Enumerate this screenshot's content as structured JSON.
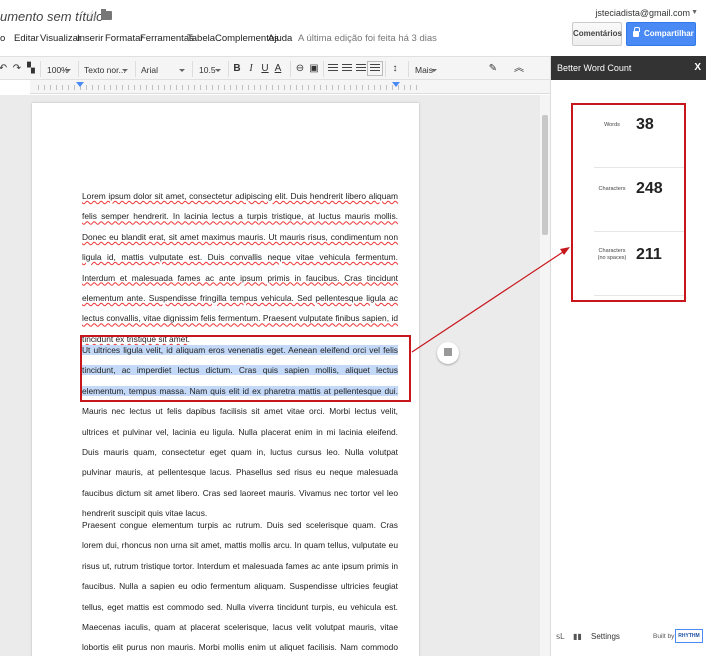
{
  "window": {
    "doc_title": "umento sem título",
    "user_email": "jsteciadista@gmail.com",
    "last_edit": "A última edição foi feita há 3 dias",
    "comments_label": "Comentários",
    "share_label": "Compartilhar"
  },
  "menu": [
    "o",
    "Editar",
    "Visualizar",
    "Inserir",
    "Formatar",
    "Ferramentas",
    "Tabela",
    "Complementos",
    "Ajuda"
  ],
  "toolbar": {
    "zoom": "100%",
    "style": "Texto nor...",
    "font": "Arial",
    "size": "10.5",
    "bold": "B",
    "italic": "I",
    "underline": "U",
    "text_color": "A",
    "more": "Mais"
  },
  "document": {
    "paragraph1": "Lorem ipsum dolor sit amet, consectetur adipiscing elit. Duis hendrerit libero aliquam felis semper hendrerit. In lacinia lectus a turpis tristique, at luctus mauris mollis. Donec eu blandit erat, sit amet maximus mauris. Ut mauris risus, condimentum non ligula id, mattis vulputate est. Duis convallis neque vitae vehicula fermentum. Interdum et malesuada fames ac ante ipsum primis in faucibus. Cras tincidunt elementum ante. Suspendisse fringilla tempus vehicula. Sed pellentesque ligula ac lectus convallis, vitae dignissim felis fermentum. Praesent vulputate finibus sapien, id tincidunt ex tristique sit amet.",
    "paragraph2_selected": "Ut ultrices ligula velit, id aliquam eros venenatis eget. Aenean eleifend orci vel felis tincidunt, ac imperdiet lectus dictum. Cras quis sapien mollis, aliquet lectus elementum, tempus massa. Nam quis elit id ex pharetra mattis at pellentesque dui.",
    "paragraph2_rest": " Mauris nec lectus ut felis dapibus facilisis sit amet vitae orci. Morbi lectus velit, ultrices et pulvinar vel, lacinia eu ligula. Nulla placerat enim in mi lacinia eleifend. Duis mauris quam, consectetur eget quam in, luctus cursus leo. Nulla volutpat pulvinar mauris, at pellentesque lacus. Phasellus sed risus eu neque malesuada faucibus dictum sit amet libero. Cras sed laoreet mauris. Vivamus nec tortor vel leo hendrerit suscipit quis vitae lacus.",
    "paragraph3": "Praesent congue elementum turpis ac rutrum. Duis sed scelerisque quam. Cras lorem dui, rhoncus non urna sit amet, mattis mollis arcu. In quam tellus, vulputate eu risus ut, rutrum tristique tortor. Interdum et malesuada fames ac ante ipsum primis in faucibus. Nulla a sapien eu odio fermentum aliquam. Suspendisse ultricies feugiat tellus, eget mattis est commodo sed. Nulla viverra tincidunt turpis, eu vehicula est. Maecenas iaculis, quam at placerat scelerisque, lacus velit volutpat mauris, vitae lobortis elit purus non mauris. Morbi mollis enim ut aliquet facilisis. Nam commodo arcu eu ullamcorper consequat. Integer eros turpis, convallis eget"
  },
  "sidebar": {
    "title": "Better Word Count",
    "close": "X",
    "stats": [
      {
        "label": "Words",
        "value": "38"
      },
      {
        "label": "Characters",
        "value": "248"
      },
      {
        "label": "Characters\n(no spaces)",
        "value": "211"
      }
    ],
    "settings_label": "Settings",
    "built_by": "Built by",
    "brand": "RHYTHM"
  },
  "colors": {
    "accent": "#4a8af4",
    "highlight": "#c3d9f7",
    "annotation": "#c8161d",
    "sidebar_header": "#333333"
  }
}
